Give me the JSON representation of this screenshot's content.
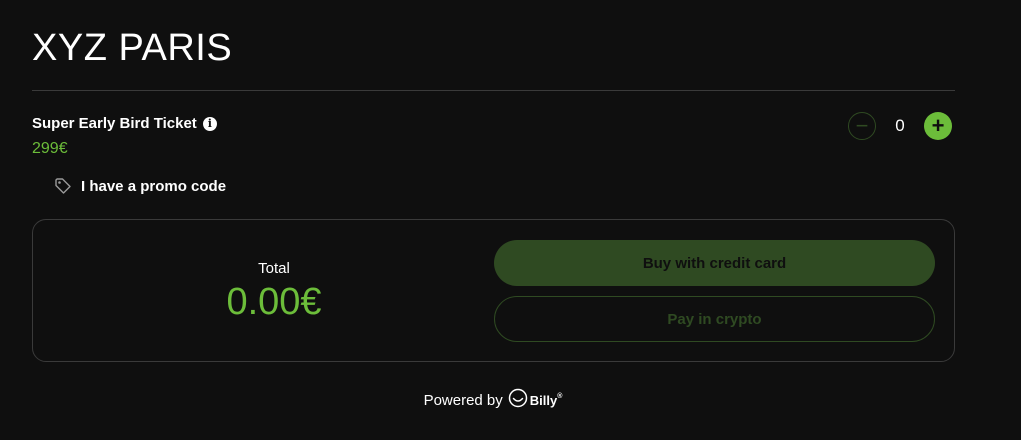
{
  "event": {
    "title": "XYZ PARIS"
  },
  "ticket": {
    "name": "Super Early Bird Ticket",
    "info_icon": "info-icon",
    "price": "299€",
    "quantity": "0",
    "minus_label": "−",
    "plus_label": "+"
  },
  "promo": {
    "icon": "tag-icon",
    "label": "I have a promo code"
  },
  "summary": {
    "total_label": "Total",
    "total_amount": "0.00€",
    "buy_card_label": "Buy with credit card",
    "pay_crypto_label": "Pay in crypto"
  },
  "footer": {
    "powered_by": "Powered by",
    "brand": "Billy",
    "brand_mark": "®",
    "brand_icon": "smiley-icon"
  },
  "colors": {
    "background": "#0f0f0f",
    "accent": "#6cbd3a",
    "disabled_accent": "#2f4a22",
    "border": "#3a3a3a"
  }
}
